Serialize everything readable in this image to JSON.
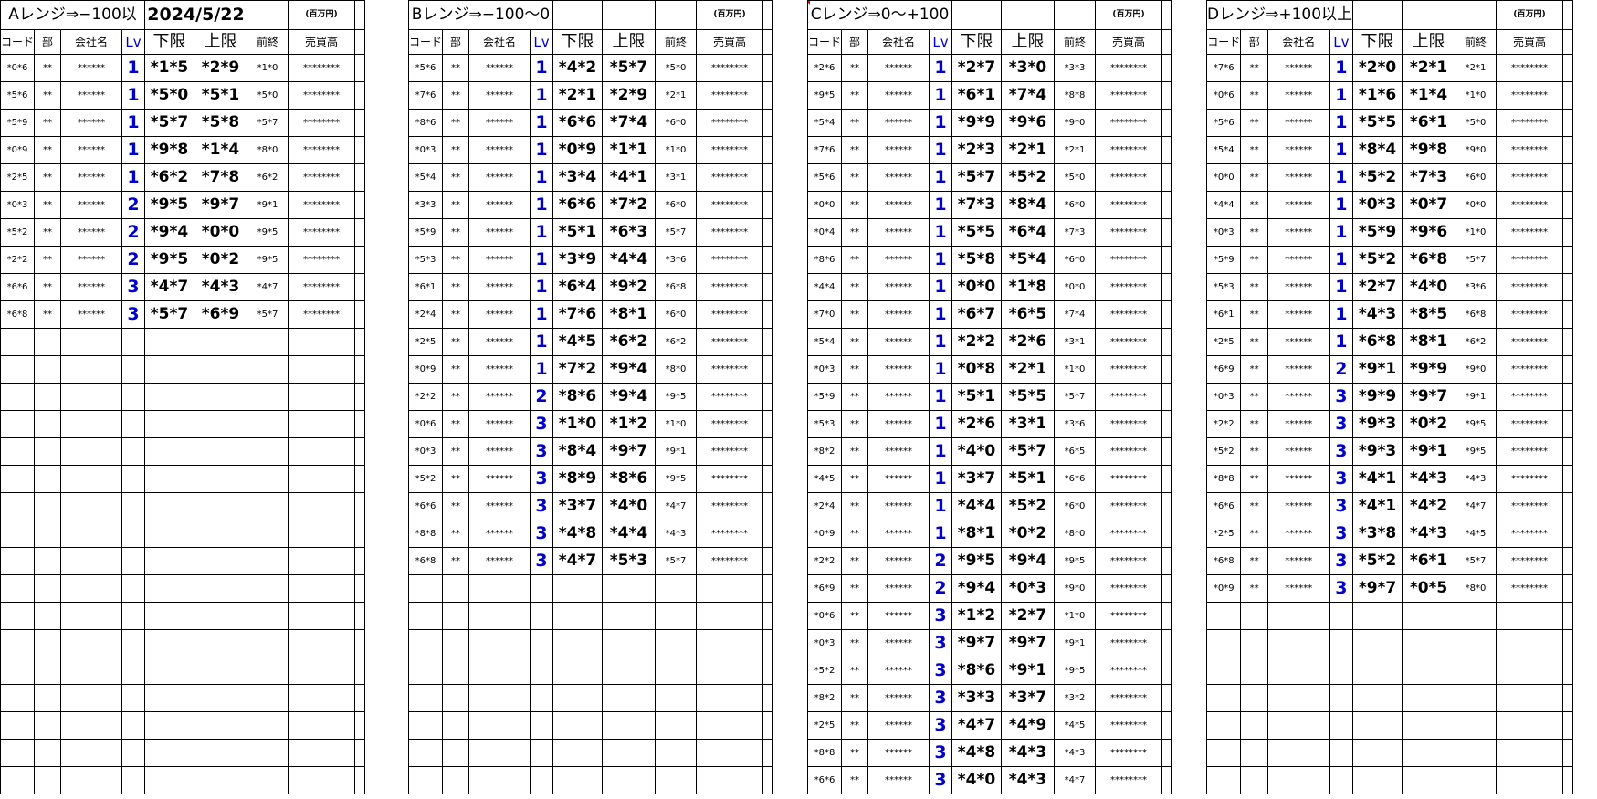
{
  "header": {
    "date": "2024/5/22",
    "unit_label": "(百万円)"
  },
  "columns": {
    "code": "コード",
    "dept": "部",
    "company": "会社名",
    "lv": "Lv",
    "lower": "下限",
    "upper": "上限",
    "prev": "前終",
    "sales": "売買高"
  },
  "blocks": [
    {
      "id": "a",
      "title": "Aレンジ⇒−100以",
      "rows": [
        [
          "*0*6",
          "**",
          "******",
          "1",
          "*1*5",
          "*2*9",
          "*1*0",
          "********"
        ],
        [
          "*5*6",
          "**",
          "******",
          "1",
          "*5*0",
          "*5*1",
          "*5*0",
          "********"
        ],
        [
          "*5*9",
          "**",
          "******",
          "1",
          "*5*7",
          "*5*8",
          "*5*7",
          "********"
        ],
        [
          "*0*9",
          "**",
          "******",
          "1",
          "*9*8",
          "*1*4",
          "*8*0",
          "********"
        ],
        [
          "*2*5",
          "**",
          "******",
          "1",
          "*6*2",
          "*7*8",
          "*6*2",
          "********"
        ],
        [
          "*0*3",
          "**",
          "******",
          "2",
          "*9*5",
          "*9*7",
          "*9*1",
          "********"
        ],
        [
          "*5*2",
          "**",
          "******",
          "2",
          "*9*4",
          "*0*0",
          "*9*5",
          "********"
        ],
        [
          "*2*2",
          "**",
          "******",
          "2",
          "*9*5",
          "*0*2",
          "*9*5",
          "********"
        ],
        [
          "*6*6",
          "**",
          "******",
          "3",
          "*4*7",
          "*4*3",
          "*4*7",
          "********"
        ],
        [
          "*6*8",
          "**",
          "******",
          "3",
          "*5*7",
          "*6*9",
          "*5*7",
          "********"
        ]
      ]
    },
    {
      "id": "b",
      "title": "Bレンジ⇒−100〜0",
      "rows": [
        [
          "*5*6",
          "**",
          "******",
          "1",
          "*4*2",
          "*5*7",
          "*5*0",
          "********"
        ],
        [
          "*7*6",
          "**",
          "******",
          "1",
          "*2*1",
          "*2*9",
          "*2*1",
          "********"
        ],
        [
          "*8*6",
          "**",
          "******",
          "1",
          "*6*6",
          "*7*4",
          "*6*0",
          "********"
        ],
        [
          "*0*3",
          "**",
          "******",
          "1",
          "*0*9",
          "*1*1",
          "*1*0",
          "********"
        ],
        [
          "*5*4",
          "**",
          "******",
          "1",
          "*3*4",
          "*4*1",
          "*3*1",
          "********"
        ],
        [
          "*3*3",
          "**",
          "******",
          "1",
          "*6*6",
          "*7*2",
          "*6*0",
          "********"
        ],
        [
          "*5*9",
          "**",
          "******",
          "1",
          "*5*1",
          "*6*3",
          "*5*7",
          "********"
        ],
        [
          "*5*3",
          "**",
          "******",
          "1",
          "*3*9",
          "*4*4",
          "*3*6",
          "********"
        ],
        [
          "*6*1",
          "**",
          "******",
          "1",
          "*6*4",
          "*9*2",
          "*6*8",
          "********"
        ],
        [
          "*2*4",
          "**",
          "******",
          "1",
          "*7*6",
          "*8*1",
          "*6*0",
          "********"
        ],
        [
          "*2*5",
          "**",
          "******",
          "1",
          "*4*5",
          "*6*2",
          "*6*2",
          "********"
        ],
        [
          "*0*9",
          "**",
          "******",
          "1",
          "*7*2",
          "*9*4",
          "*8*0",
          "********"
        ],
        [
          "*2*2",
          "**",
          "******",
          "2",
          "*8*6",
          "*9*4",
          "*9*5",
          "********"
        ],
        [
          "*0*6",
          "**",
          "******",
          "3",
          "*1*0",
          "*1*2",
          "*1*0",
          "********"
        ],
        [
          "*0*3",
          "**",
          "******",
          "3",
          "*8*4",
          "*9*7",
          "*9*1",
          "********"
        ],
        [
          "*5*2",
          "**",
          "******",
          "3",
          "*8*9",
          "*8*6",
          "*9*5",
          "********"
        ],
        [
          "*6*6",
          "**",
          "******",
          "3",
          "*3*7",
          "*4*0",
          "*4*7",
          "********"
        ],
        [
          "*8*8",
          "**",
          "******",
          "3",
          "*4*8",
          "*4*4",
          "*4*3",
          "********"
        ],
        [
          "*6*8",
          "**",
          "******",
          "3",
          "*4*7",
          "*5*3",
          "*5*7",
          "********"
        ]
      ]
    },
    {
      "id": "c",
      "title": "Cレンジ⇒0〜+100",
      "rows": [
        [
          "*2*6",
          "**",
          "******",
          "1",
          "*2*7",
          "*3*0",
          "*3*3",
          "********"
        ],
        [
          "*9*5",
          "**",
          "******",
          "1",
          "*6*1",
          "*7*4",
          "*8*8",
          "********"
        ],
        [
          "*5*4",
          "**",
          "******",
          "1",
          "*9*9",
          "*9*6",
          "*9*0",
          "********"
        ],
        [
          "*7*6",
          "**",
          "******",
          "1",
          "*2*3",
          "*2*1",
          "*2*1",
          "********"
        ],
        [
          "*5*6",
          "**",
          "******",
          "1",
          "*5*7",
          "*5*2",
          "*5*0",
          "********"
        ],
        [
          "*0*0",
          "**",
          "******",
          "1",
          "*7*3",
          "*8*4",
          "*6*0",
          "********"
        ],
        [
          "*0*4",
          "**",
          "******",
          "1",
          "*5*5",
          "*6*4",
          "*7*3",
          "********"
        ],
        [
          "*8*6",
          "**",
          "******",
          "1",
          "*5*8",
          "*5*4",
          "*6*0",
          "********"
        ],
        [
          "*4*4",
          "**",
          "******",
          "1",
          "*0*0",
          "*1*8",
          "*0*0",
          "********"
        ],
        [
          "*7*0",
          "**",
          "******",
          "1",
          "*6*7",
          "*6*5",
          "*7*4",
          "********"
        ],
        [
          "*5*4",
          "**",
          "******",
          "1",
          "*2*2",
          "*2*6",
          "*3*1",
          "********"
        ],
        [
          "*0*3",
          "**",
          "******",
          "1",
          "*0*8",
          "*2*1",
          "*1*0",
          "********"
        ],
        [
          "*5*9",
          "**",
          "******",
          "1",
          "*5*1",
          "*5*5",
          "*5*7",
          "********"
        ],
        [
          "*5*3",
          "**",
          "******",
          "1",
          "*2*6",
          "*3*1",
          "*3*6",
          "********"
        ],
        [
          "*8*2",
          "**",
          "******",
          "1",
          "*4*0",
          "*5*7",
          "*6*5",
          "********"
        ],
        [
          "*4*5",
          "**",
          "******",
          "1",
          "*3*7",
          "*5*1",
          "*6*6",
          "********"
        ],
        [
          "*2*4",
          "**",
          "******",
          "1",
          "*4*4",
          "*5*2",
          "*6*0",
          "********"
        ],
        [
          "*0*9",
          "**",
          "******",
          "1",
          "*8*1",
          "*0*2",
          "*8*0",
          "********"
        ],
        [
          "*2*2",
          "**",
          "******",
          "2",
          "*9*5",
          "*9*4",
          "*9*5",
          "********"
        ],
        [
          "*6*9",
          "**",
          "******",
          "2",
          "*9*4",
          "*0*3",
          "*9*0",
          "********"
        ],
        [
          "*0*6",
          "**",
          "******",
          "3",
          "*1*2",
          "*2*7",
          "*1*0",
          "********"
        ],
        [
          "*0*3",
          "**",
          "******",
          "3",
          "*9*7",
          "*9*7",
          "*9*1",
          "********"
        ],
        [
          "*5*2",
          "**",
          "******",
          "3",
          "*8*6",
          "*9*1",
          "*9*5",
          "********"
        ],
        [
          "*8*2",
          "**",
          "******",
          "3",
          "*3*3",
          "*3*7",
          "*3*2",
          "********"
        ],
        [
          "*2*5",
          "**",
          "******",
          "3",
          "*4*7",
          "*4*9",
          "*4*5",
          "********"
        ],
        [
          "*8*8",
          "**",
          "******",
          "3",
          "*4*8",
          "*4*3",
          "*4*3",
          "********"
        ],
        [
          "*6*6",
          "**",
          "******",
          "3",
          "*4*0",
          "*4*3",
          "*4*7",
          "********"
        ]
      ]
    },
    {
      "id": "d",
      "title": "Dレンジ⇒+100以上",
      "rows": [
        [
          "*7*6",
          "**",
          "******",
          "1",
          "*2*0",
          "*2*1",
          "*2*1",
          "********"
        ],
        [
          "*0*6",
          "**",
          "******",
          "1",
          "*1*6",
          "*1*4",
          "*1*0",
          "********"
        ],
        [
          "*5*6",
          "**",
          "******",
          "1",
          "*5*5",
          "*6*1",
          "*5*0",
          "********"
        ],
        [
          "*5*4",
          "**",
          "******",
          "1",
          "*8*4",
          "*9*8",
          "*9*0",
          "********"
        ],
        [
          "*0*0",
          "**",
          "******",
          "1",
          "*5*2",
          "*7*3",
          "*6*0",
          "********"
        ],
        [
          "*4*4",
          "**",
          "******",
          "1",
          "*0*3",
          "*0*7",
          "*0*0",
          "********"
        ],
        [
          "*0*3",
          "**",
          "******",
          "1",
          "*5*9",
          "*9*6",
          "*1*0",
          "********"
        ],
        [
          "*5*9",
          "**",
          "******",
          "1",
          "*5*2",
          "*6*8",
          "*5*7",
          "********"
        ],
        [
          "*5*3",
          "**",
          "******",
          "1",
          "*2*7",
          "*4*0",
          "*3*6",
          "********"
        ],
        [
          "*6*1",
          "**",
          "******",
          "1",
          "*4*3",
          "*8*5",
          "*6*8",
          "********"
        ],
        [
          "*2*5",
          "**",
          "******",
          "1",
          "*6*8",
          "*8*1",
          "*6*2",
          "********"
        ],
        [
          "*6*9",
          "**",
          "******",
          "2",
          "*9*1",
          "*9*9",
          "*9*0",
          "********"
        ],
        [
          "*0*3",
          "**",
          "******",
          "3",
          "*9*9",
          "*9*7",
          "*9*1",
          "********"
        ],
        [
          "*2*2",
          "**",
          "******",
          "3",
          "*9*3",
          "*0*2",
          "*9*5",
          "********"
        ],
        [
          "*5*2",
          "**",
          "******",
          "3",
          "*9*3",
          "*9*1",
          "*9*5",
          "********"
        ],
        [
          "*8*8",
          "**",
          "******",
          "3",
          "*4*1",
          "*4*3",
          "*4*3",
          "********"
        ],
        [
          "*6*6",
          "**",
          "******",
          "3",
          "*4*1",
          "*4*2",
          "*4*7",
          "********"
        ],
        [
          "*2*5",
          "**",
          "******",
          "3",
          "*3*8",
          "*4*3",
          "*4*5",
          "********"
        ],
        [
          "*6*8",
          "**",
          "******",
          "3",
          "*5*2",
          "*6*1",
          "*5*7",
          "********"
        ],
        [
          "*0*9",
          "**",
          "******",
          "3",
          "*9*7",
          "*0*5",
          "*8*0",
          "********"
        ]
      ]
    }
  ]
}
